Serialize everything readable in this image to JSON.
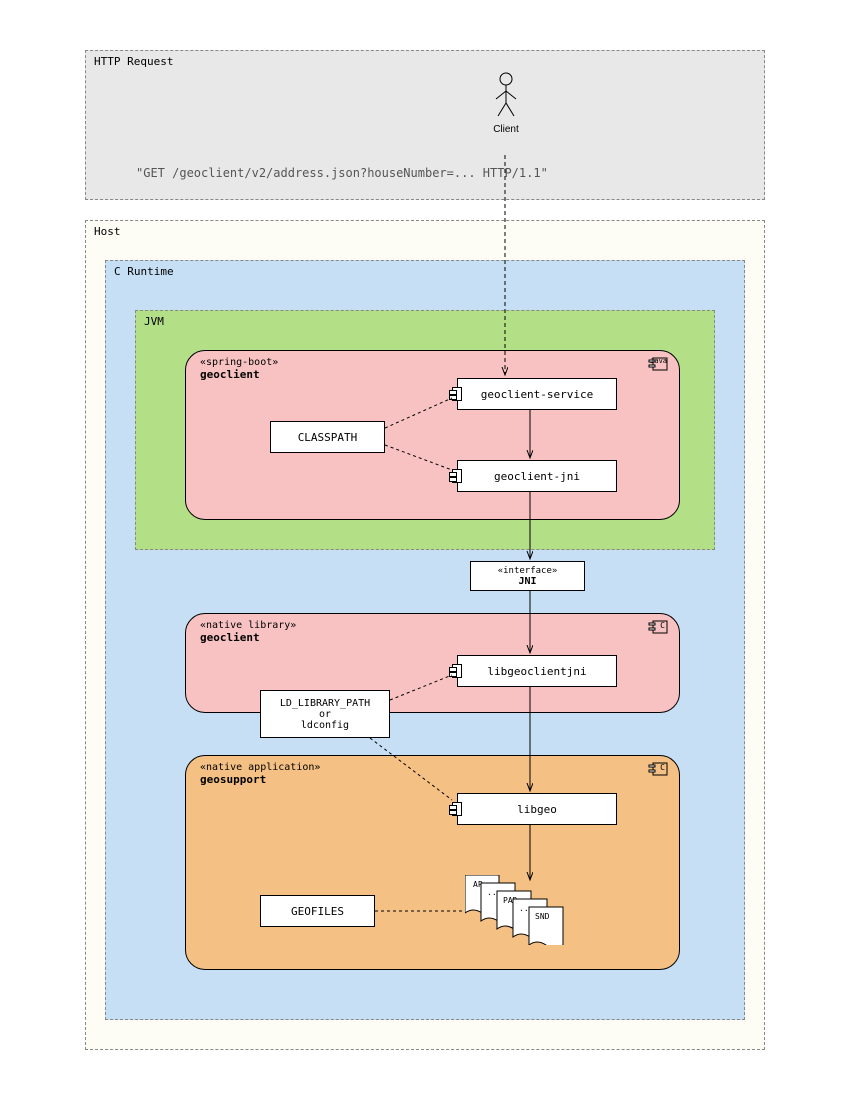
{
  "http": {
    "label": "HTTP Request",
    "actor": "Client",
    "request": "\"GET /geoclient/v2/address.json?houseNumber=... HTTP/1.1\""
  },
  "host": {
    "label": "Host"
  },
  "cruntime": {
    "label": "C Runtime"
  },
  "jvm": {
    "label": "JVM"
  },
  "springboot": {
    "stereotype": "«spring-boot»",
    "name": "geoclient",
    "badge": "Java",
    "classpath": "CLASSPATH",
    "service": "geoclient-service",
    "jni": "geoclient-jni"
  },
  "jni_iface": {
    "stereotype": "«interface»",
    "name": "JNI"
  },
  "nativelib": {
    "stereotype": "«native library»",
    "name": "geoclient",
    "badge": "C",
    "ldpath1": "LD_LIBRARY_PATH",
    "ldpath2": "or",
    "ldpath3": "ldconfig",
    "lib": "libgeoclientjni"
  },
  "geosupport": {
    "stereotype": "«native application»",
    "name": "geosupport",
    "badge": "C",
    "libgeo": "libgeo",
    "geofiles": "GEOFILES",
    "file1": "AP",
    "file2": "PAD",
    "file3": "SND"
  }
}
